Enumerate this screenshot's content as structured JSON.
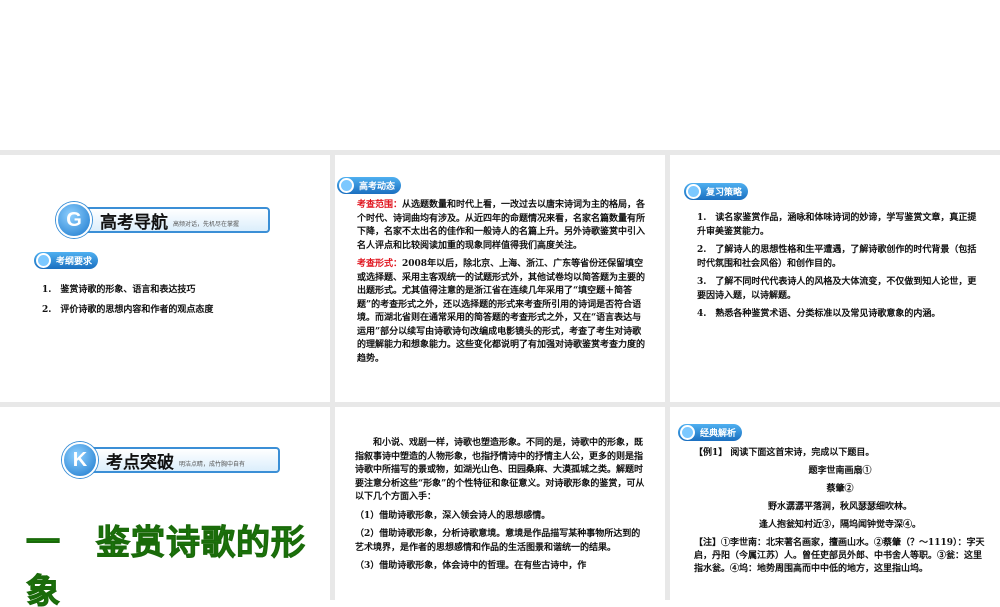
{
  "slides": [
    {
      "banner": {
        "letter": "G",
        "title": "高考导航",
        "subtitle": "高频对话，先机尽在掌握"
      },
      "tag": "考纲要求",
      "items": [
        "1.　鉴赏诗歌的形象、语言和表达技巧",
        "2.　评价诗歌的思想内容和作者的观点态度"
      ]
    },
    {
      "tag": "高考动态",
      "p1_label": "考查范围：",
      "p1": "从选题数量和时代上看，一改过去以唐宋诗词为主的格局，各个时代、诗词曲均有涉及。从近四年的命题情况来看，名家名篇数量有所下降，名家不太出名的佳作和一般诗人的名篇上升。另外诗歌鉴赏中引入名人评点和比较阅读加重的现象同样值得我们高度关注。",
      "p2_label": "考查形式：",
      "p2": "2008年以后，除北京、上海、浙江、广东等省份还保留填空或选择题、采用主客观统一的试题形式外，其他试卷均以简答题为主要的出题形式。尤其值得注意的是浙江省在连续几年采用了“填空题＋简答题”的考查形式之外，还以选择题的形式来考查所引用的诗词是否符合语境。而湖北省则在通常采用的简答题的考查形式之外，又在“语言表达与运用”部分以续写由诗歌诗句改编成电影镜头的形式，考查了考生对诗歌的理解能力和想象能力。这些变化都说明了有加强对诗歌鉴赏考查力度的趋势。"
    },
    {
      "tag": "复习策略",
      "items": [
        "1.　读名家鉴赏作品，涵咏和体味诗词的妙谛，学写鉴赏文章，真正提升审美鉴赏能力。",
        "2.　了解诗人的思想性格和生平遭遇，了解诗歌创作的时代背景（包括时代氛围和社会风俗）和创作目的。",
        "3.　了解不同时代代表诗人的风格及大体流变，不仅做到知人论世，更要因诗入题，以诗解题。",
        "4.　熟悉各种鉴赏术语、分类标准以及常见诗歌意象的内涵。"
      ]
    },
    {
      "banner": {
        "letter": "K",
        "title": "考点突破",
        "subtitle": "明洁点睛，成竹胸中自有"
      },
      "heading": "一　鉴赏诗歌的形象"
    },
    {
      "intro": "和小说、戏剧一样，诗歌也塑造形象。不同的是，诗歌中的形象，既指叙事诗中塑造的人物形象，也指抒情诗中的抒情主人公，更多的则是指诗歌中所描写的景或物，如湖光山色、田园桑麻、大漠孤城之类。解题时要注意分析这些“形象”的个性特征和象征意义。对诗歌形象的鉴赏，可从以下几个方面入手：",
      "points": [
        "（1）借助诗歌形象，深入领会诗人的思想感情。",
        "（2）借助诗歌形象，分析诗歌意境。意境是作品描写某种事物所达到的艺术境界，是作者的思想感情和作品的生活图景和谐统一的结果。",
        "（3）借助诗歌形象，体会诗中的哲理。在有些古诗中，作"
      ]
    },
    {
      "tag": "经典解析",
      "question": "【例1】 阅读下面这首宋诗，完成以下题目。",
      "poem_title": "题李世南画扇①",
      "author": "蔡肇②",
      "lines": [
        "野水潺潺平落涧，秋风瑟瑟细吹林。",
        "逢人抱瓮知村近③，隔坞闻钟觉寺深④。"
      ],
      "note": "【注】①李世南：北宋著名画家，擅画山水。②蔡肇（？～1119）：字天启，丹阳（今属江苏）人。曾任吏部员外郎、中书舍人等职。③瓮：这里指水瓮。④坞：地势周围高而中中低的地方，这里指山坞。"
    }
  ]
}
